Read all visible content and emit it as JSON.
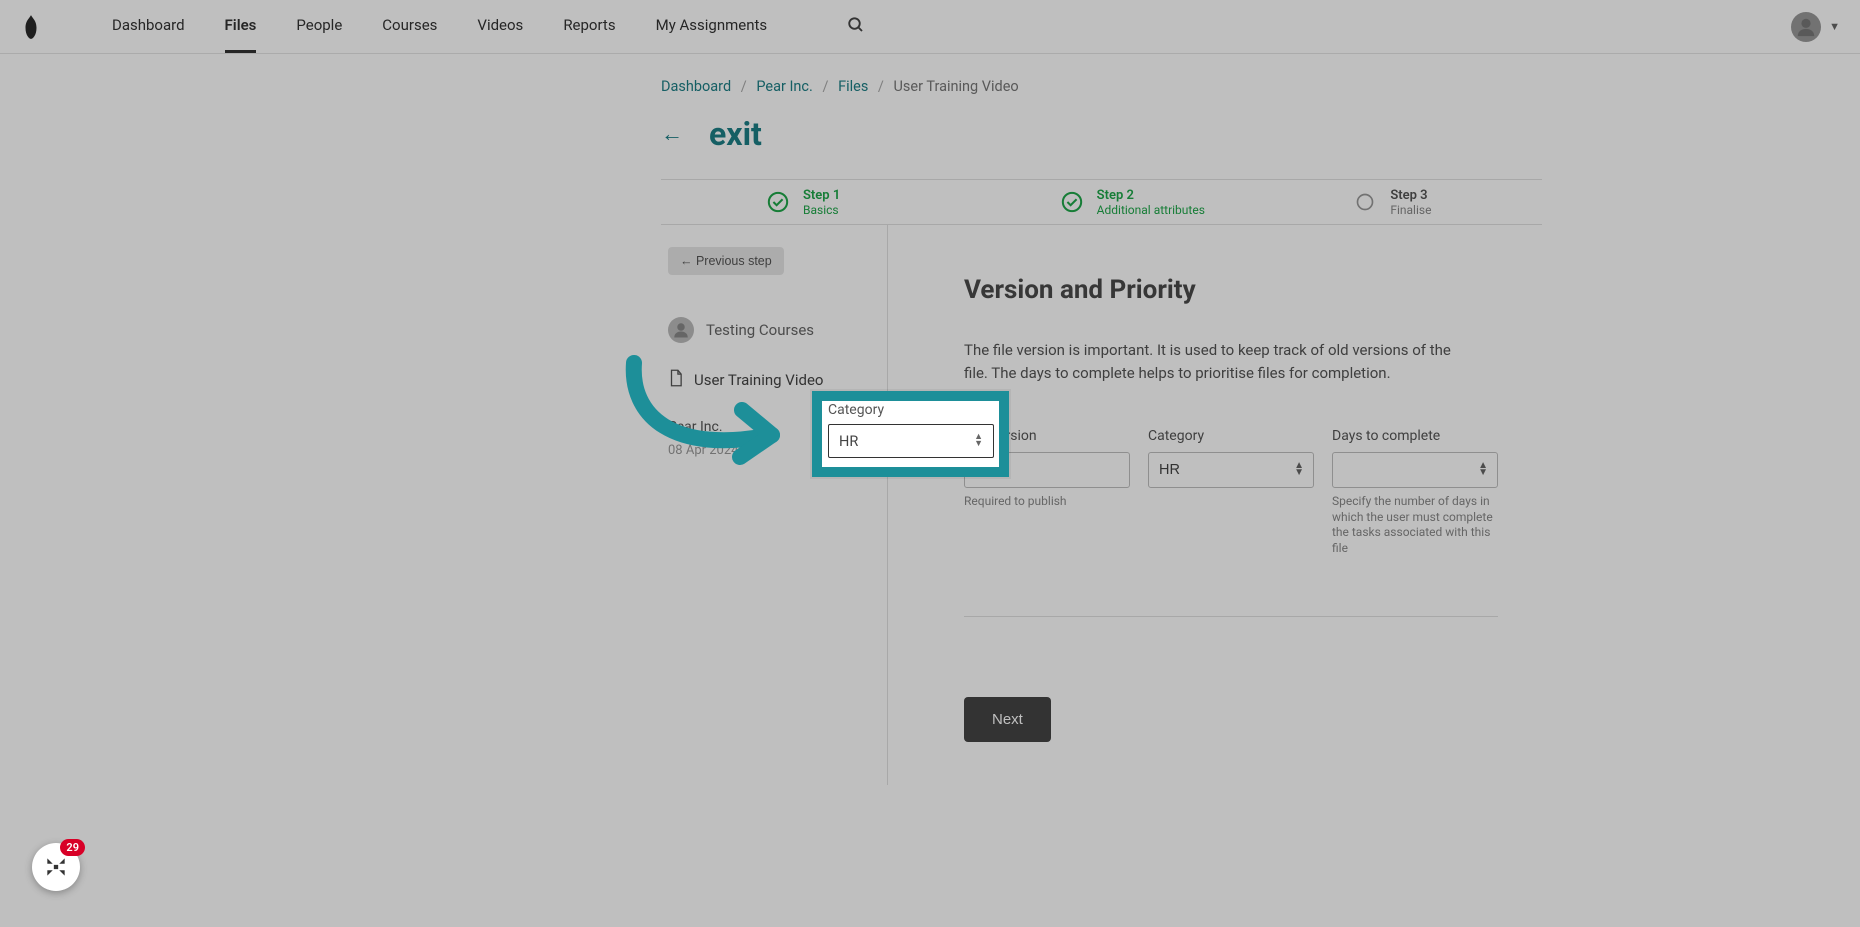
{
  "nav": {
    "items": [
      "Dashboard",
      "Files",
      "People",
      "Courses",
      "Videos",
      "Reports",
      "My Assignments"
    ],
    "active_index": 1
  },
  "breadcrumbs": {
    "items": [
      "Dashboard",
      "Pear Inc.",
      "Files",
      "User Training Video"
    ]
  },
  "exit_label": "exit",
  "steps": [
    {
      "title": "Step 1",
      "sub": "Basics",
      "state": "done"
    },
    {
      "title": "Step 2",
      "sub": "Additional attributes",
      "state": "done"
    },
    {
      "title": "Step 3",
      "sub": "Finalise",
      "state": "pending"
    }
  ],
  "side": {
    "prev_label": "← Previous step",
    "user": "Testing Courses",
    "file": "User Training Video",
    "org": "Pear Inc.",
    "date": "08 Apr 2024"
  },
  "form": {
    "title": "Version and Priority",
    "desc": "The file version is important. It is used to keep track of old versions of the file. The days to complete helps to prioritise files for completion.",
    "fields": {
      "version": {
        "label": "File Version",
        "value": "1",
        "hint": "Required to publish"
      },
      "category": {
        "label": "Category",
        "value": "HR"
      },
      "days": {
        "label": "Days to complete",
        "value": "",
        "hint": "Specify the number of days in which the user must complete the tasks associated with this file"
      }
    },
    "next_label": "Next"
  },
  "widget": {
    "badge": "29"
  }
}
